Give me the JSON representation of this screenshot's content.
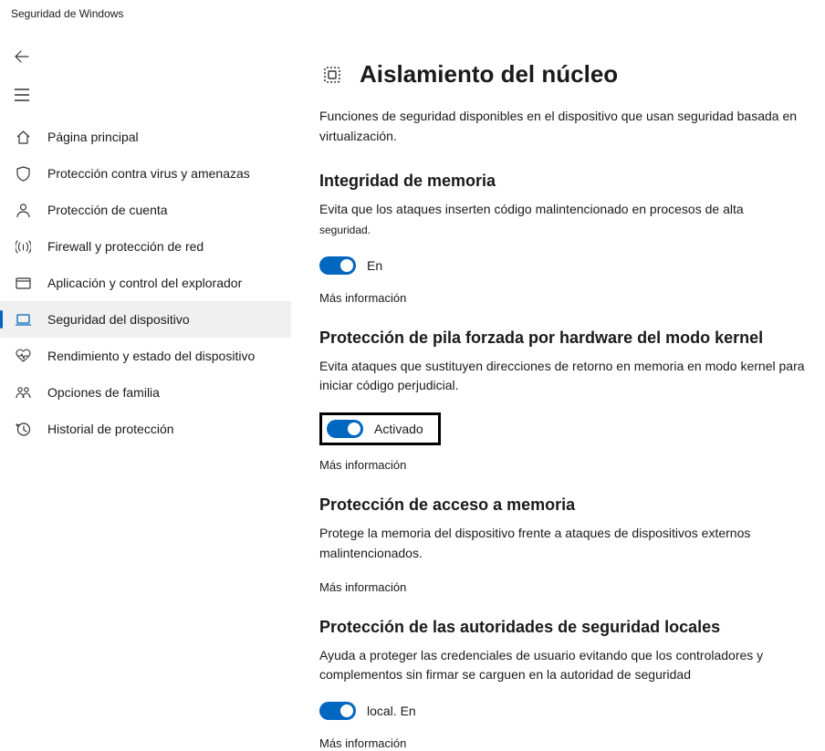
{
  "window_title": "Seguridad de Windows",
  "sidebar": {
    "items": [
      {
        "label": "Página principal"
      },
      {
        "label": "Protección contra virus y amenazas"
      },
      {
        "label": "Protección de cuenta"
      },
      {
        "label": "Firewall y protección de red"
      },
      {
        "label": "Aplicación y control del explorador"
      },
      {
        "label": "Seguridad del dispositivo"
      },
      {
        "label": "Rendimiento y estado del dispositivo"
      },
      {
        "label": "Opciones de familia"
      },
      {
        "label": "Historial de protección"
      }
    ]
  },
  "main": {
    "title": "Aislamiento del núcleo",
    "subtitle": "Funciones de seguridad disponibles en el dispositivo que usan seguridad basada en virtualización.",
    "sections": {
      "memory_integrity": {
        "title": "Integridad de memoria",
        "desc_line1": "Evita que los ataques inserten código malintencionado en procesos de alta",
        "desc_line2": "seguridad.",
        "toggle_label": "En",
        "learn_more": "Más información"
      },
      "kernel_stack": {
        "title": "Protección de pila forzada por hardware del modo kernel",
        "desc": "Evita ataques que sustituyen direcciones de retorno en memoria en modo kernel para iniciar código perjudicial.",
        "toggle_label": "Activado",
        "learn_more": "Más información"
      },
      "memory_access": {
        "title": "Protección de acceso a memoria",
        "desc": "Protege la memoria del dispositivo frente a ataques de dispositivos externos malintencionados.",
        "learn_more": "Más información"
      },
      "lsa": {
        "title": "Protección de las autoridades de seguridad locales",
        "desc": "Ayuda a proteger las credenciales de usuario evitando que los controladores y complementos sin firmar se carguen en la autoridad de seguridad",
        "toggle_label": "local. En",
        "learn_more": "Más información"
      }
    }
  }
}
